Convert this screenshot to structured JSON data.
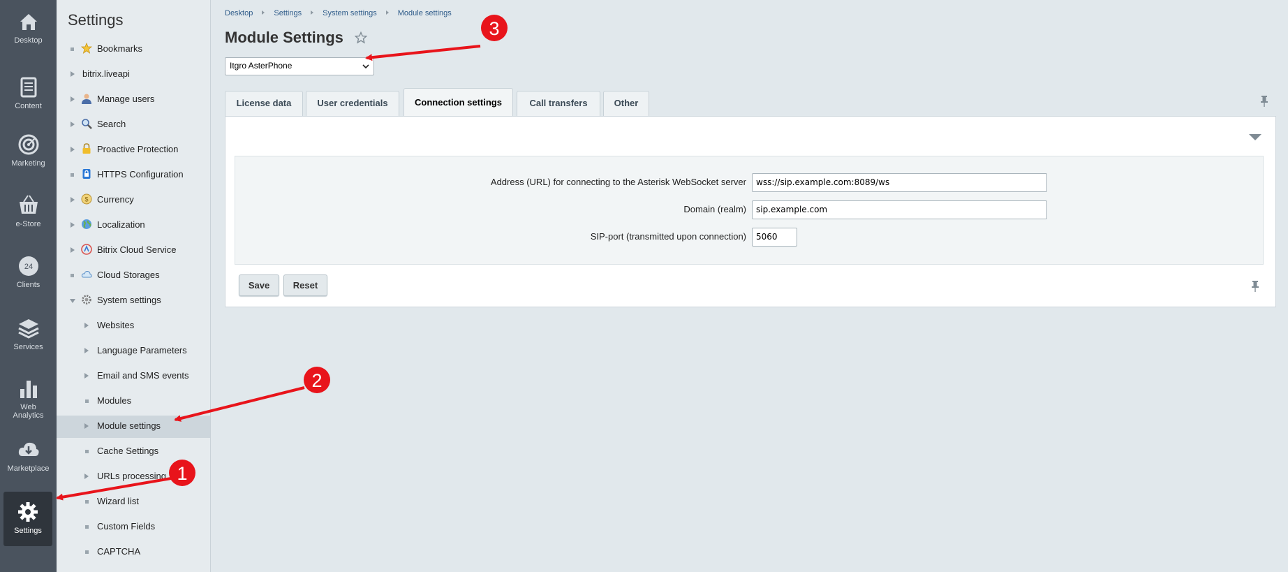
{
  "rail": {
    "items": [
      {
        "label": "Desktop",
        "icon": "home-icon"
      },
      {
        "label": "Content",
        "icon": "document-icon"
      },
      {
        "label": "Marketing",
        "icon": "target-icon"
      },
      {
        "label": "e-Store",
        "icon": "basket-icon"
      },
      {
        "label": "Clients",
        "icon": "clients-24-icon"
      },
      {
        "label": "Services",
        "icon": "layers-icon"
      },
      {
        "label": "Web",
        "label2": "Analytics",
        "icon": "bar-chart-icon"
      },
      {
        "label": "Marketplace",
        "icon": "cloud-download-icon"
      },
      {
        "label": "Settings",
        "icon": "gear-icon"
      }
    ],
    "clients_badge": "24"
  },
  "menu": {
    "title": "Settings",
    "items": [
      {
        "label": "Bookmarks"
      },
      {
        "label": "bitrix.liveapi"
      },
      {
        "label": "Manage users"
      },
      {
        "label": "Search"
      },
      {
        "label": "Proactive Protection"
      },
      {
        "label": "HTTPS Configuration"
      },
      {
        "label": "Currency"
      },
      {
        "label": "Localization"
      },
      {
        "label": "Bitrix Cloud Service"
      },
      {
        "label": "Cloud Storages"
      },
      {
        "label": "System settings"
      },
      {
        "label": "Websites"
      },
      {
        "label": "Language Parameters"
      },
      {
        "label": "Email and SMS events"
      },
      {
        "label": "Modules"
      },
      {
        "label": "Module settings"
      },
      {
        "label": "Cache Settings"
      },
      {
        "label": "URLs processing"
      },
      {
        "label": "Wizard list"
      },
      {
        "label": "Custom Fields"
      },
      {
        "label": "CAPTCHA"
      }
    ]
  },
  "breadcrumb": [
    "Desktop",
    "Settings",
    "System settings",
    "Module settings"
  ],
  "page": {
    "title": "Module Settings",
    "module_select": "Itgro AsterPhone"
  },
  "tabs": [
    "License data",
    "User credentials",
    "Connection settings",
    "Call transfers",
    "Other"
  ],
  "active_tab": "Connection settings",
  "form": {
    "ws_label": "Address (URL) for connecting to the Asterisk WebSocket server",
    "ws_value": "wss://sip.example.com:8089/ws",
    "realm_label": "Domain (realm)",
    "realm_value": "sip.example.com",
    "port_label": "SIP-port (transmitted upon connection)",
    "port_value": "5060"
  },
  "buttons": {
    "save": "Save",
    "reset": "Reset"
  },
  "annotations": {
    "one": "1",
    "two": "2",
    "three": "3",
    "color": "#e8141b"
  },
  "colors": {
    "rail_bg": "#4a535e",
    "menu_bg": "#e6ebee",
    "link": "#2f5c8a"
  }
}
